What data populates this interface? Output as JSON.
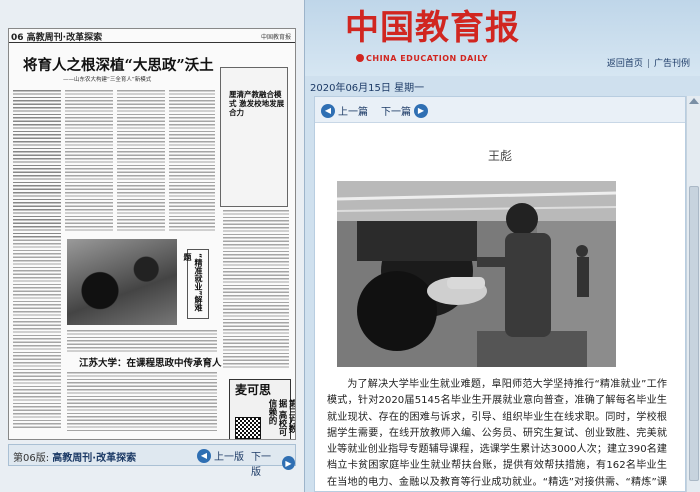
{
  "header": {
    "logo_cn": "中国教育报",
    "logo_en": "CHINA EDUCATION DAILY",
    "links": [
      "返回首页",
      "广告刊例"
    ]
  },
  "left_page": {
    "section_label": "06 高教周刊·改革探索",
    "masthead_small": "中国教育报",
    "headline": "将育人之根深植“大思政”沃土",
    "subhead": "——山东农大构建“三全育人”新模式",
    "sidebox_title": "厘清产教融合模式 激发校地发展合力",
    "vertical_title": "“精准就业”解难题",
    "col_headline": "江苏大学：在课程思政中传承育人",
    "mai_title": "麦可思",
    "mai_vertical": "第三方数据 高校可信赖的",
    "nav": {
      "current_prefix": "第06版:",
      "current_title": "高教周刊·改革探索",
      "prev": "上一版",
      "next": "下一版"
    }
  },
  "date_text": "2020年06月15日 星期一",
  "article_nav": {
    "prev": "上一篇",
    "next": "下一篇"
  },
  "author": "王彪",
  "article_text": "为了解决大学毕业生就业难题，阜阳师范大学坚持推行“精准就业”工作模式，针对2020届5145名毕业生开展就业意向普查，准确了解每名毕业生就业现状、存在的困难与诉求，引导、组织毕业生在线求职。同时，学校根据学生需要，在线开放教师入编、公务员、研究生复试、创业致胜、完美就业等就业创业指导专题辅导课程，选课学生累计达3000人次；建立390名建档立卡贫困家庭毕业生就业帮扶台账，提供有效帮扶措施，有162名毕业生在当地的电力、金融以及教育等行业成功就业。“精选”对接供需、“精炼”课程、“精到”帮扶等措施，最大限度降低疫情",
  "icons": [
    "arrow-left-icon",
    "arrow-right-icon",
    "scroll-up-icon"
  ]
}
